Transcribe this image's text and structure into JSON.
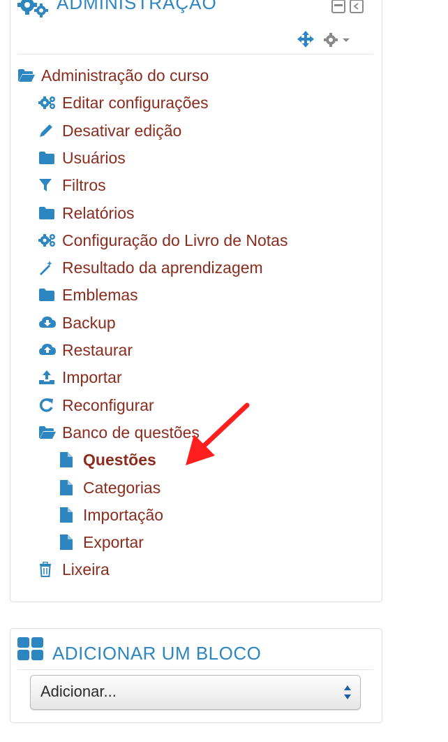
{
  "admin_block": {
    "title": "ADMINISTRAÇÃO",
    "tree": [
      {
        "label": "Administração do curso",
        "icon": "folder-open-icon",
        "level": 0,
        "bold": false
      },
      {
        "label": "Editar configurações",
        "icon": "gears-icon",
        "level": 1,
        "bold": false
      },
      {
        "label": "Desativar edição",
        "icon": "pencil-icon",
        "level": 1,
        "bold": false
      },
      {
        "label": "Usuários",
        "icon": "folder-icon",
        "level": 1,
        "bold": false
      },
      {
        "label": "Filtros",
        "icon": "filter-icon",
        "level": 1,
        "bold": false
      },
      {
        "label": "Relatórios",
        "icon": "folder-icon",
        "level": 1,
        "bold": false
      },
      {
        "label": "Configuração do Livro de Notas",
        "icon": "gears-icon",
        "level": 1,
        "bold": false
      },
      {
        "label": "Resultado da aprendizagem",
        "icon": "magic-wand-icon",
        "level": 1,
        "bold": false
      },
      {
        "label": "Emblemas",
        "icon": "folder-icon",
        "level": 1,
        "bold": false
      },
      {
        "label": "Backup",
        "icon": "cloud-download-icon",
        "level": 1,
        "bold": false
      },
      {
        "label": "Restaurar",
        "icon": "cloud-upload-icon",
        "level": 1,
        "bold": false
      },
      {
        "label": "Importar",
        "icon": "upload-icon",
        "level": 1,
        "bold": false
      },
      {
        "label": "Reconfigurar",
        "icon": "refresh-icon",
        "level": 1,
        "bold": false
      },
      {
        "label": "Banco de questões",
        "icon": "folder-open-icon",
        "level": 1,
        "bold": false
      },
      {
        "label": "Questões",
        "icon": "file-icon",
        "level": 2,
        "bold": true
      },
      {
        "label": "Categorias",
        "icon": "file-icon",
        "level": 2,
        "bold": false
      },
      {
        "label": "Importação",
        "icon": "file-icon",
        "level": 2,
        "bold": false
      },
      {
        "label": "Exportar",
        "icon": "file-icon",
        "level": 2,
        "bold": false
      },
      {
        "label": "Lixeira",
        "icon": "trash-icon",
        "level": 1,
        "bold": false
      }
    ]
  },
  "add_block": {
    "title": "ADICIONAR UM BLOCO",
    "select_value": "Adicionar..."
  },
  "colors": {
    "link": "#8b2c1e",
    "icon": "#2e86c1",
    "arrow": "#ff1f1f"
  }
}
